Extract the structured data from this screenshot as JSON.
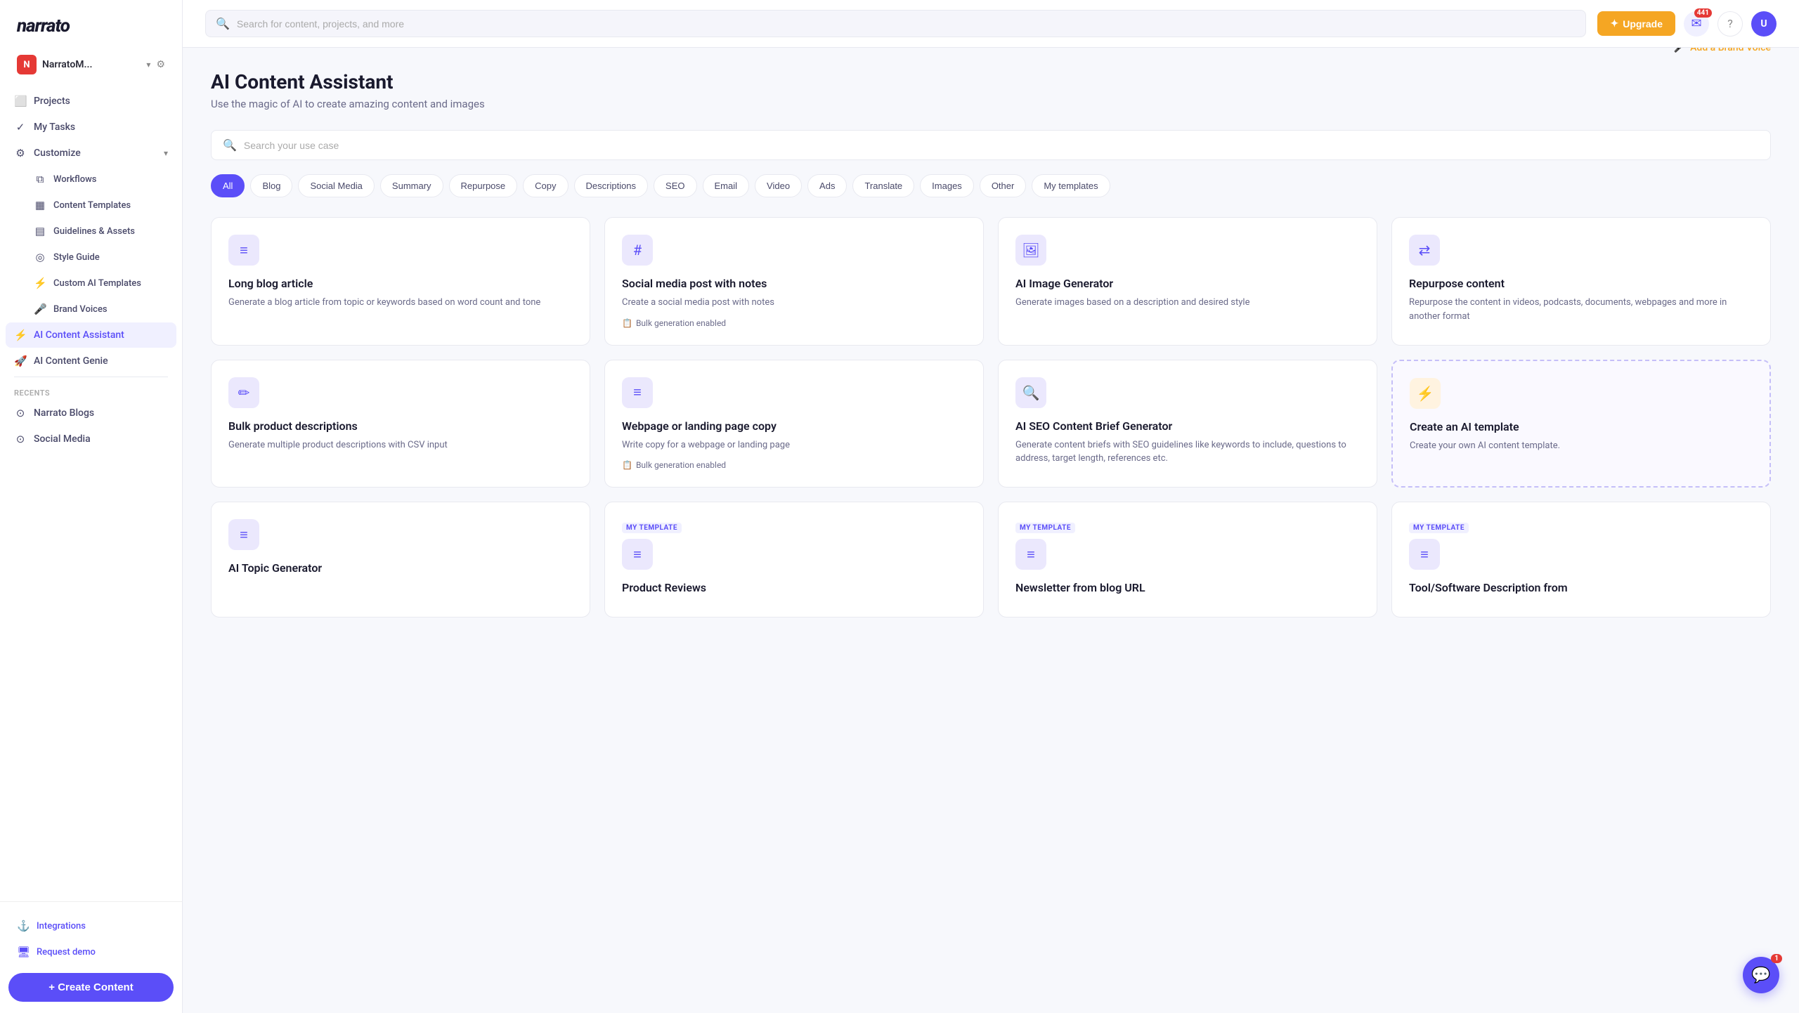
{
  "app": {
    "name": "narrato",
    "logo": "narrato"
  },
  "account": {
    "initials": "N",
    "name": "NarratoM...",
    "badge_color": "#e53935"
  },
  "sidebar": {
    "nav_items": [
      {
        "id": "projects",
        "label": "Projects",
        "icon": "⬜",
        "active": false
      },
      {
        "id": "my-tasks",
        "label": "My Tasks",
        "icon": "✓",
        "active": false
      },
      {
        "id": "customize",
        "label": "Customize",
        "icon": "⚙",
        "active": false,
        "has_sub": true
      }
    ],
    "sub_items": [
      {
        "id": "workflows",
        "label": "Workflows",
        "icon": "⧉",
        "active": false
      },
      {
        "id": "content-templates",
        "label": "Content Templates",
        "icon": "▦",
        "active": false
      },
      {
        "id": "guidelines-assets",
        "label": "Guidelines & Assets",
        "icon": "▤",
        "active": false
      },
      {
        "id": "style-guide",
        "label": "Style Guide",
        "icon": "◎",
        "active": false
      },
      {
        "id": "custom-ai-templates",
        "label": "Custom AI Templates",
        "icon": "⚡",
        "active": false
      },
      {
        "id": "brand-voices",
        "label": "Brand Voices",
        "icon": "🎤",
        "active": false
      }
    ],
    "main_items": [
      {
        "id": "ai-content-assistant",
        "label": "AI Content Assistant",
        "icon": "⚡",
        "active": true
      },
      {
        "id": "ai-content-genie",
        "label": "AI Content Genie",
        "icon": "🚀",
        "active": false
      }
    ],
    "recents_label": "Recents",
    "recent_items": [
      {
        "id": "narrato-blogs",
        "label": "Narrato Blogs",
        "icon": "⊙"
      },
      {
        "id": "social-media",
        "label": "Social Media",
        "icon": "⊙"
      }
    ],
    "bottom_items": [
      {
        "id": "integrations",
        "label": "Integrations",
        "icon": "⚓"
      },
      {
        "id": "request-demo",
        "label": "Request demo",
        "icon": "🖥"
      }
    ],
    "create_button": "+ Create Content"
  },
  "topbar": {
    "search_placeholder": "Search for content, projects, and more",
    "upgrade_label": "Upgrade",
    "notification_count": "441",
    "help_icon": "?",
    "user_initials": "U"
  },
  "page": {
    "title": "AI Content Assistant",
    "subtitle": "Use the magic of AI to create amazing content and images",
    "brand_voice_label": "Add a Brand Voice",
    "use_case_placeholder": "Search your use case",
    "filters": [
      {
        "id": "all",
        "label": "All",
        "active": true
      },
      {
        "id": "blog",
        "label": "Blog",
        "active": false
      },
      {
        "id": "social-media",
        "label": "Social Media",
        "active": false
      },
      {
        "id": "summary",
        "label": "Summary",
        "active": false
      },
      {
        "id": "repurpose",
        "label": "Repurpose",
        "active": false
      },
      {
        "id": "copy",
        "label": "Copy",
        "active": false
      },
      {
        "id": "descriptions",
        "label": "Descriptions",
        "active": false
      },
      {
        "id": "seo",
        "label": "SEO",
        "active": false
      },
      {
        "id": "email",
        "label": "Email",
        "active": false
      },
      {
        "id": "video",
        "label": "Video",
        "active": false
      },
      {
        "id": "ads",
        "label": "Ads",
        "active": false
      },
      {
        "id": "translate",
        "label": "Translate",
        "active": false
      },
      {
        "id": "images",
        "label": "Images",
        "active": false
      },
      {
        "id": "other",
        "label": "Other",
        "active": false
      },
      {
        "id": "my-templates",
        "label": "My templates",
        "active": false
      }
    ],
    "cards": [
      {
        "id": "long-blog-article",
        "icon": "≡",
        "icon_type": "default",
        "title": "Long blog article",
        "desc": "Generate a blog article from topic or keywords based on word count and tone",
        "bulk": false,
        "dashed": false,
        "my_template": false
      },
      {
        "id": "social-media-post",
        "icon": "#",
        "icon_type": "default",
        "title": "Social media post with notes",
        "desc": "Create a social media post with notes",
        "bulk": true,
        "bulk_label": "Bulk generation enabled",
        "dashed": false,
        "my_template": false
      },
      {
        "id": "ai-image-generator",
        "icon": "🖼",
        "icon_type": "default",
        "title": "AI Image Generator",
        "desc": "Generate images based on a description and desired style",
        "bulk": false,
        "dashed": false,
        "my_template": false
      },
      {
        "id": "repurpose-content",
        "icon": "⇄",
        "icon_type": "default",
        "title": "Repurpose content",
        "desc": "Repurpose the content in videos, podcasts, documents, webpages and more in another format",
        "bulk": false,
        "dashed": false,
        "my_template": false
      },
      {
        "id": "bulk-product-descriptions",
        "icon": "✏",
        "icon_type": "default",
        "title": "Bulk product descriptions",
        "desc": "Generate multiple product descriptions with CSV input",
        "bulk": false,
        "dashed": false,
        "my_template": false
      },
      {
        "id": "webpage-landing-page",
        "icon": "≡",
        "icon_type": "default",
        "title": "Webpage or landing page copy",
        "desc": "Write copy for a webpage or landing page",
        "bulk": true,
        "bulk_label": "Bulk generation enabled",
        "dashed": false,
        "my_template": false
      },
      {
        "id": "ai-seo-content-brief",
        "icon": "🔍",
        "icon_type": "default",
        "title": "AI SEO Content Brief Generator",
        "desc": "Generate content briefs with SEO guidelines like keywords to include, questions to address, target length, references etc.",
        "bulk": false,
        "dashed": false,
        "my_template": false
      },
      {
        "id": "create-ai-template",
        "icon": "⚡",
        "icon_type": "yellow",
        "title": "Create an AI template",
        "desc": "Create your own AI content template.",
        "bulk": false,
        "dashed": true,
        "my_template": false
      },
      {
        "id": "ai-topic-generator",
        "icon": "≡",
        "icon_type": "default",
        "title": "AI Topic Generator",
        "desc": "",
        "bulk": false,
        "dashed": false,
        "my_template": false,
        "partial": true
      },
      {
        "id": "product-reviews",
        "icon": "≡",
        "icon_type": "default",
        "title": "Product Reviews",
        "desc": "",
        "bulk": false,
        "dashed": false,
        "my_template": true,
        "partial": true
      },
      {
        "id": "newsletter-from-blog",
        "icon": "≡",
        "icon_type": "default",
        "title": "Newsletter from blog URL",
        "desc": "",
        "bulk": false,
        "dashed": false,
        "my_template": true,
        "partial": true
      },
      {
        "id": "tool-software-description",
        "icon": "≡",
        "icon_type": "default",
        "title": "Tool/Software Description from",
        "desc": "",
        "bulk": false,
        "dashed": false,
        "my_template": true,
        "partial": true
      }
    ]
  },
  "chat": {
    "badge": "1"
  }
}
